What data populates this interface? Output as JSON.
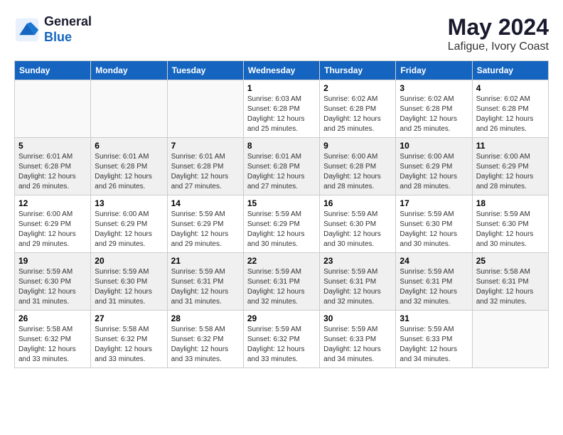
{
  "header": {
    "logo_line1": "General",
    "logo_line2": "Blue",
    "month_year": "May 2024",
    "location": "Lafigue, Ivory Coast"
  },
  "weekdays": [
    "Sunday",
    "Monday",
    "Tuesday",
    "Wednesday",
    "Thursday",
    "Friday",
    "Saturday"
  ],
  "weeks": [
    [
      {
        "day": "",
        "info": ""
      },
      {
        "day": "",
        "info": ""
      },
      {
        "day": "",
        "info": ""
      },
      {
        "day": "1",
        "info": "Sunrise: 6:03 AM\nSunset: 6:28 PM\nDaylight: 12 hours\nand 25 minutes."
      },
      {
        "day": "2",
        "info": "Sunrise: 6:02 AM\nSunset: 6:28 PM\nDaylight: 12 hours\nand 25 minutes."
      },
      {
        "day": "3",
        "info": "Sunrise: 6:02 AM\nSunset: 6:28 PM\nDaylight: 12 hours\nand 25 minutes."
      },
      {
        "day": "4",
        "info": "Sunrise: 6:02 AM\nSunset: 6:28 PM\nDaylight: 12 hours\nand 26 minutes."
      }
    ],
    [
      {
        "day": "5",
        "info": "Sunrise: 6:01 AM\nSunset: 6:28 PM\nDaylight: 12 hours\nand 26 minutes."
      },
      {
        "day": "6",
        "info": "Sunrise: 6:01 AM\nSunset: 6:28 PM\nDaylight: 12 hours\nand 26 minutes."
      },
      {
        "day": "7",
        "info": "Sunrise: 6:01 AM\nSunset: 6:28 PM\nDaylight: 12 hours\nand 27 minutes."
      },
      {
        "day": "8",
        "info": "Sunrise: 6:01 AM\nSunset: 6:28 PM\nDaylight: 12 hours\nand 27 minutes."
      },
      {
        "day": "9",
        "info": "Sunrise: 6:00 AM\nSunset: 6:28 PM\nDaylight: 12 hours\nand 28 minutes."
      },
      {
        "day": "10",
        "info": "Sunrise: 6:00 AM\nSunset: 6:29 PM\nDaylight: 12 hours\nand 28 minutes."
      },
      {
        "day": "11",
        "info": "Sunrise: 6:00 AM\nSunset: 6:29 PM\nDaylight: 12 hours\nand 28 minutes."
      }
    ],
    [
      {
        "day": "12",
        "info": "Sunrise: 6:00 AM\nSunset: 6:29 PM\nDaylight: 12 hours\nand 29 minutes."
      },
      {
        "day": "13",
        "info": "Sunrise: 6:00 AM\nSunset: 6:29 PM\nDaylight: 12 hours\nand 29 minutes."
      },
      {
        "day": "14",
        "info": "Sunrise: 5:59 AM\nSunset: 6:29 PM\nDaylight: 12 hours\nand 29 minutes."
      },
      {
        "day": "15",
        "info": "Sunrise: 5:59 AM\nSunset: 6:29 PM\nDaylight: 12 hours\nand 30 minutes."
      },
      {
        "day": "16",
        "info": "Sunrise: 5:59 AM\nSunset: 6:30 PM\nDaylight: 12 hours\nand 30 minutes."
      },
      {
        "day": "17",
        "info": "Sunrise: 5:59 AM\nSunset: 6:30 PM\nDaylight: 12 hours\nand 30 minutes."
      },
      {
        "day": "18",
        "info": "Sunrise: 5:59 AM\nSunset: 6:30 PM\nDaylight: 12 hours\nand 30 minutes."
      }
    ],
    [
      {
        "day": "19",
        "info": "Sunrise: 5:59 AM\nSunset: 6:30 PM\nDaylight: 12 hours\nand 31 minutes."
      },
      {
        "day": "20",
        "info": "Sunrise: 5:59 AM\nSunset: 6:30 PM\nDaylight: 12 hours\nand 31 minutes."
      },
      {
        "day": "21",
        "info": "Sunrise: 5:59 AM\nSunset: 6:31 PM\nDaylight: 12 hours\nand 31 minutes."
      },
      {
        "day": "22",
        "info": "Sunrise: 5:59 AM\nSunset: 6:31 PM\nDaylight: 12 hours\nand 32 minutes."
      },
      {
        "day": "23",
        "info": "Sunrise: 5:59 AM\nSunset: 6:31 PM\nDaylight: 12 hours\nand 32 minutes."
      },
      {
        "day": "24",
        "info": "Sunrise: 5:59 AM\nSunset: 6:31 PM\nDaylight: 12 hours\nand 32 minutes."
      },
      {
        "day": "25",
        "info": "Sunrise: 5:58 AM\nSunset: 6:31 PM\nDaylight: 12 hours\nand 32 minutes."
      }
    ],
    [
      {
        "day": "26",
        "info": "Sunrise: 5:58 AM\nSunset: 6:32 PM\nDaylight: 12 hours\nand 33 minutes."
      },
      {
        "day": "27",
        "info": "Sunrise: 5:58 AM\nSunset: 6:32 PM\nDaylight: 12 hours\nand 33 minutes."
      },
      {
        "day": "28",
        "info": "Sunrise: 5:58 AM\nSunset: 6:32 PM\nDaylight: 12 hours\nand 33 minutes."
      },
      {
        "day": "29",
        "info": "Sunrise: 5:59 AM\nSunset: 6:32 PM\nDaylight: 12 hours\nand 33 minutes."
      },
      {
        "day": "30",
        "info": "Sunrise: 5:59 AM\nSunset: 6:33 PM\nDaylight: 12 hours\nand 34 minutes."
      },
      {
        "day": "31",
        "info": "Sunrise: 5:59 AM\nSunset: 6:33 PM\nDaylight: 12 hours\nand 34 minutes."
      },
      {
        "day": "",
        "info": ""
      }
    ]
  ]
}
